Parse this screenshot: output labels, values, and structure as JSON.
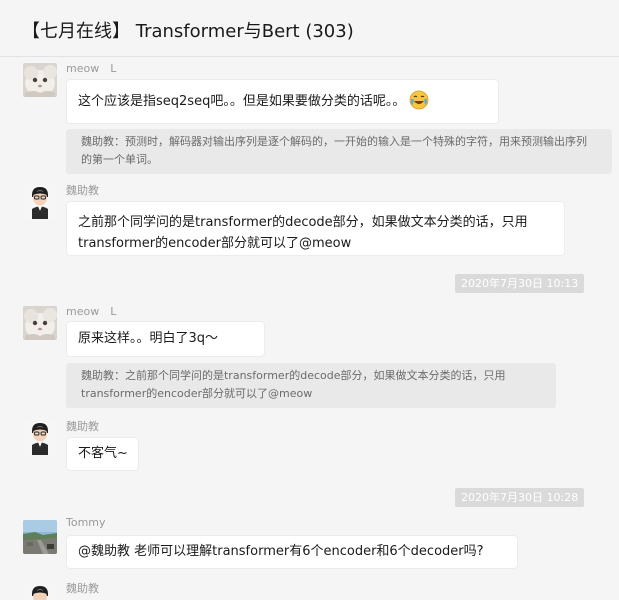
{
  "window": {
    "title": "【七月在线】 Transformer与Bert (303)"
  },
  "messages": [
    {
      "sender": "meow　L",
      "text": "这个应该是指seq2seq吧。。但是如果要做分类的话呢。。",
      "emoji": "crying-laughing-emoji",
      "quote": "魏助教：预测时，解码器对输出序列是逐个解码的，一开始的输入是一个特殊的字符，用来预测输出序列的第一个单词。"
    },
    {
      "sender": "魏助教",
      "text": "之前那个同学问的是transformer的decode部分，如果做文本分类的话，只用transformer的encoder部分就可以了@meow"
    },
    {
      "timestamp": "2020年7月30日 10:13"
    },
    {
      "sender": "meow　L",
      "text": "原来这样。。明白了3q～",
      "quote": "魏助教：之前那个同学问的是transformer的decode部分，如果做文本分类的话，只用transformer的encoder部分就可以了@meow"
    },
    {
      "sender": "魏助教",
      "text": "不客气~"
    },
    {
      "timestamp": "2020年7月30日 10:28"
    },
    {
      "sender": "Tommy",
      "text": "@魏助教 老师可以理解transformer有6个encoder和6个decoder吗?"
    },
    {
      "sender": "魏助教"
    }
  ]
}
